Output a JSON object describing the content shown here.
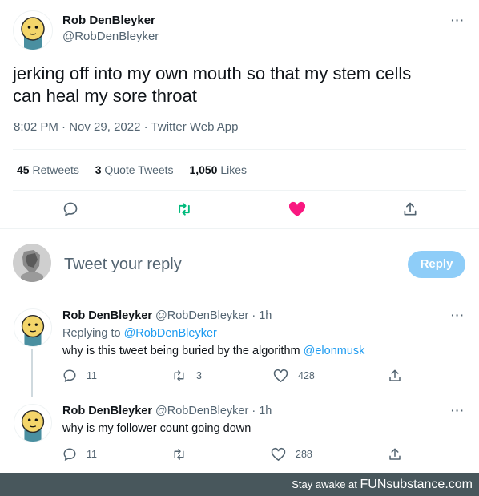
{
  "tweet": {
    "name": "Rob DenBleyker",
    "handle": "@RobDenBleyker",
    "text_line1": "jerking off into my own mouth so that my stem cells",
    "text_line2": "can heal my sore throat",
    "time": "8:02 PM",
    "date": "Nov 29, 2022",
    "source": "Twitter Web App",
    "sep1": "·",
    "sep2": "·",
    "more": "···",
    "stats": {
      "retweets_count": "45",
      "retweets_label": "Retweets",
      "quotes_count": "3",
      "quotes_label": "Quote Tweets",
      "likes_count": "1,050",
      "likes_label": "Likes"
    }
  },
  "compose": {
    "placeholder": "Tweet your reply",
    "button": "Reply"
  },
  "replies": [
    {
      "name": "Rob DenBleyker",
      "handle": "@RobDenBleyker",
      "sep": "·",
      "age": "1h",
      "more": "···",
      "replying_prefix": "Replying to",
      "replying_handle": "@RobDenBleyker",
      "text": "why is this tweet being buried by the algorithm",
      "mention": "@elonmusk",
      "replies": "11",
      "retweets": "3",
      "likes": "428"
    },
    {
      "name": "Rob DenBleyker",
      "handle": "@RobDenBleyker",
      "sep": "·",
      "age": "1h",
      "more": "···",
      "text": "why is my follower count going down",
      "replies": "11",
      "likes": "288"
    }
  ],
  "footer": {
    "prefix": "Stay awake at",
    "brand": "FUNsubstance",
    "suffix": ".com"
  },
  "colors": {
    "like_pink": "#f91880",
    "retweet_green": "#00ba7c",
    "link_blue": "#1d9bf0",
    "reply_button": "#8ecdf8",
    "footer_bg": "#48575c"
  }
}
